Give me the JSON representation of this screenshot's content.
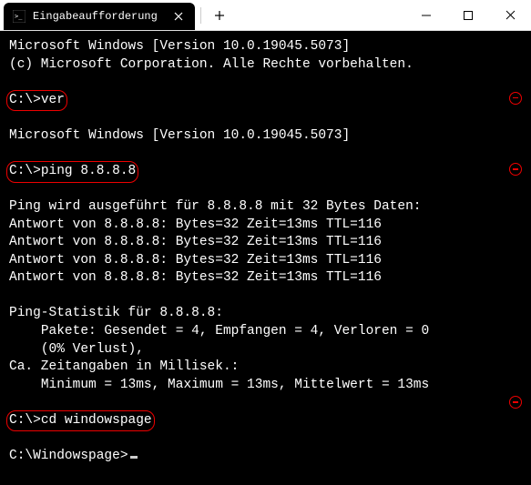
{
  "titlebar": {
    "tab_title": "Eingabeaufforderung"
  },
  "header": {
    "line1": "Microsoft Windows [Version 10.0.19045.5073]",
    "line2": "(c) Microsoft Corporation. Alle Rechte vorbehalten."
  },
  "blocks": [
    {
      "prompt": "C:\\>",
      "command": "ver",
      "output": [
        "Microsoft Windows [Version 10.0.19045.5073]"
      ]
    },
    {
      "prompt": "C:\\>",
      "command": "ping 8.8.8.8",
      "output": [
        "Ping wird ausgeführt für 8.8.8.8 mit 32 Bytes Daten:",
        "Antwort von 8.8.8.8: Bytes=32 Zeit=13ms TTL=116",
        "Antwort von 8.8.8.8: Bytes=32 Zeit=13ms TTL=116",
        "Antwort von 8.8.8.8: Bytes=32 Zeit=13ms TTL=116",
        "Antwort von 8.8.8.8: Bytes=32 Zeit=13ms TTL=116",
        "",
        "Ping-Statistik für 8.8.8.8:",
        "    Pakete: Gesendet = 4, Empfangen = 4, Verloren = 0",
        "    (0% Verlust),",
        "Ca. Zeitangaben in Millisek.:",
        "    Minimum = 13ms, Maximum = 13ms, Mittelwert = 13ms"
      ]
    },
    {
      "prompt": "C:\\>",
      "command": "cd windowspage",
      "output": []
    }
  ],
  "current_prompt": "C:\\Windowspage>"
}
